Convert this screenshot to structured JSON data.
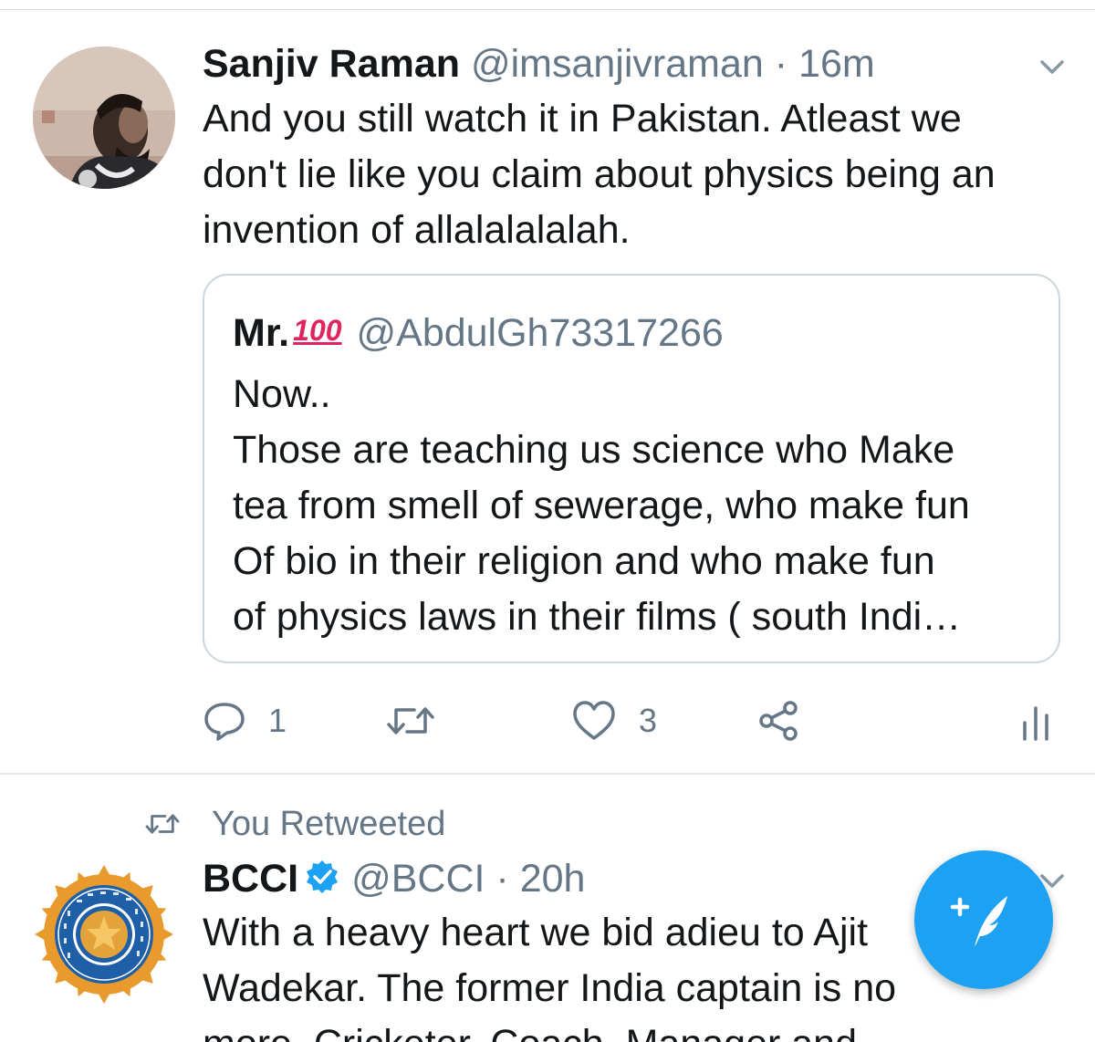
{
  "tweets": [
    {
      "author": {
        "name": "Sanjiv Raman",
        "handle": "@imsanjivraman",
        "avatar_icon": "profile-photo"
      },
      "separator": "·",
      "time": "16m",
      "lines": [
        "And you still watch it in Pakistan. Atleast we",
        "don't lie like you claim about physics being an",
        "invention of allalalalalah."
      ],
      "quote": {
        "name": "Mr.",
        "name_emoji": "100",
        "handle": "@AbdulGh73317266",
        "lines": [
          "Now..",
          "Those are teaching us science who Make",
          "tea from smell of sewerage, who make fun",
          "Of bio in their religion and who make fun",
          "of physics laws in their films ( south Indi…"
        ]
      },
      "actions": {
        "reply_count": "1",
        "retweet_count": "",
        "like_count": "3"
      }
    },
    {
      "social_context": "You Retweeted",
      "author": {
        "name": "BCCI",
        "handle": "@BCCI",
        "verified": true,
        "avatar_icon": "bcci-logo"
      },
      "separator": "·",
      "time": "20h",
      "lines": [
        "With a heavy heart we bid adieu to Ajit",
        "Wadekar. The former India captain is no",
        "more. Cricketer, Coach, Manager and"
      ]
    }
  ],
  "colors": {
    "accent": "#1da1f2",
    "text": "#14171a",
    "secondary": "#657786",
    "border": "#ccd6dd",
    "emoji_red": "#e0245e"
  },
  "compose_button": {
    "icon": "compose-feather-plus-icon"
  }
}
